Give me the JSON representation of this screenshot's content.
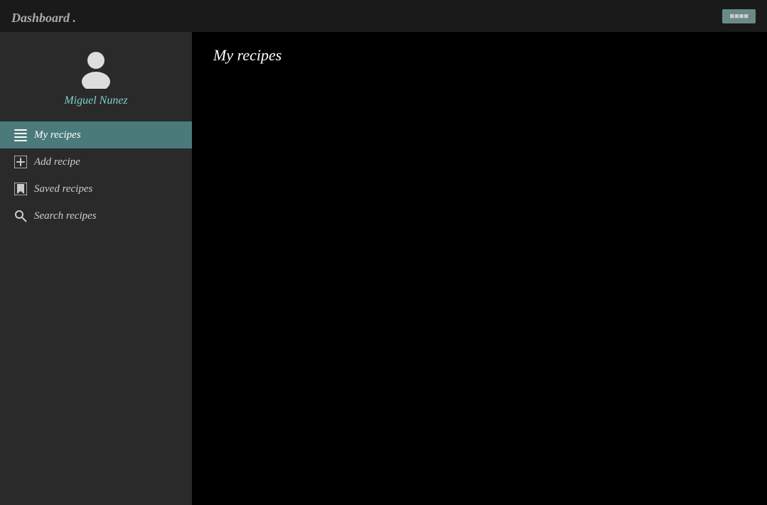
{
  "header": {
    "title": "Dashboard",
    "dot": " .",
    "button_label": "■■■■"
  },
  "sidebar": {
    "user_name": "Miguel Nunez",
    "nav_items": [
      {
        "id": "my-recipes",
        "label": "My recipes",
        "icon": "list-icon",
        "active": true
      },
      {
        "id": "add-recipe",
        "label": "Add recipe",
        "icon": "plus-icon",
        "active": false
      },
      {
        "id": "saved-recipes",
        "label": "Saved recipes",
        "icon": "bookmark-icon",
        "active": false
      },
      {
        "id": "search-recipes",
        "label": "Search recipes",
        "icon": "search-icon",
        "active": false
      }
    ]
  },
  "content": {
    "page_title": "My recipes"
  }
}
